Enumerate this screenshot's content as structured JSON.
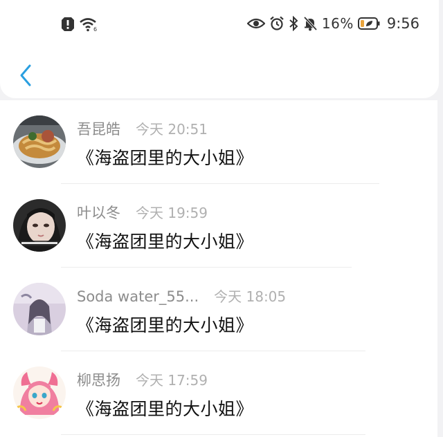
{
  "status_bar": {
    "left_icons": [
      "alert-icon",
      "wifi-icon"
    ],
    "right_icons": [
      "eye-icon",
      "alarm-icon",
      "bluetooth-icon",
      "mute-icon"
    ],
    "battery_percent": "16%",
    "time": "9:56"
  },
  "header": {
    "back_icon": "chevron-left-icon",
    "accent_color": "#2a9fe0"
  },
  "conversations": [
    {
      "name": "吾昆皓",
      "time": "今天 20:51",
      "message": "《海盗团里的大小姐》"
    },
    {
      "name": "叶以冬",
      "time": "今天 19:59",
      "message": "《海盗团里的大小姐》"
    },
    {
      "name": "Soda water_55...",
      "time": "今天 18:05",
      "message": "《海盗团里的大小姐》"
    },
    {
      "name": "柳思扬",
      "time": "今天 17:59",
      "message": "《海盗团里的大小姐》"
    }
  ]
}
